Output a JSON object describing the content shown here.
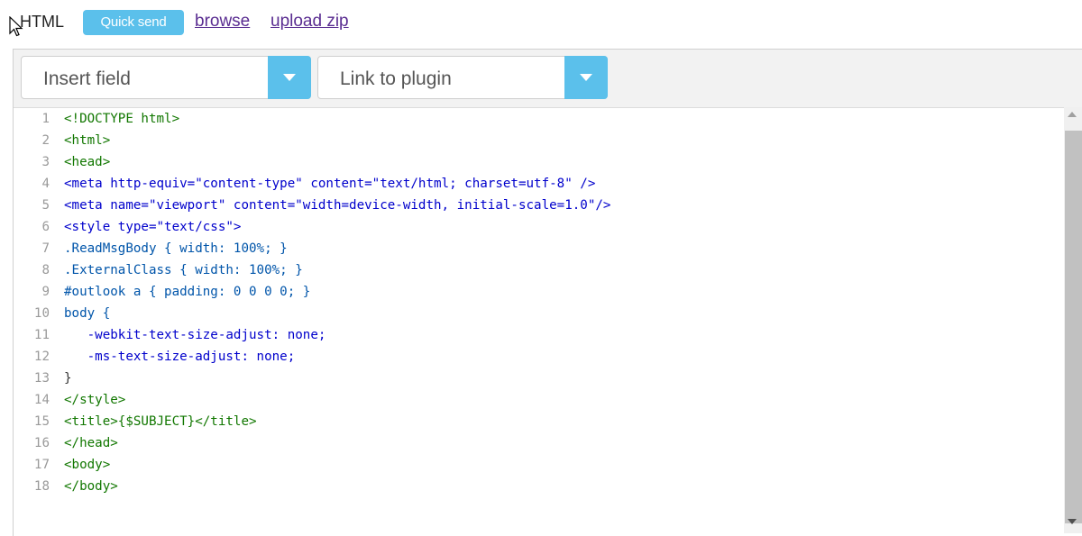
{
  "header": {
    "format_label": "HTML",
    "quick_send_label": "Quick send",
    "browse_label": "browse",
    "upload_zip_label": "upload zip"
  },
  "toolbar": {
    "insert_field_label": "Insert field",
    "link_plugin_label": "Link to plugin"
  },
  "colors": {
    "accent": "#5bc0eb",
    "link": "#5a2d91"
  },
  "code": {
    "line_numbers": [
      "1",
      "2",
      "3",
      "4",
      "5",
      "6",
      "7",
      "8",
      "9",
      "10",
      "11",
      "12",
      "13",
      "14",
      "15",
      "16",
      "17",
      "18"
    ],
    "lines": [
      "<!DOCTYPE html>",
      "<html>",
      "<head>",
      "<meta http-equiv=\"content-type\" content=\"text/html; charset=utf-8\" />",
      "<meta name=\"viewport\" content=\"width=device-width, initial-scale=1.0\"/>",
      "<style type=\"text/css\">",
      ".ReadMsgBody { width: 100%; }",
      ".ExternalClass { width: 100%; }",
      "#outlook a { padding: 0 0 0 0; }",
      "body {",
      "   -webkit-text-size-adjust: none;",
      "   -ms-text-size-adjust: none;",
      "}",
      "</style>",
      "<title>{$SUBJECT}</title>",
      "</head>",
      "<body>",
      "</body>"
    ]
  }
}
